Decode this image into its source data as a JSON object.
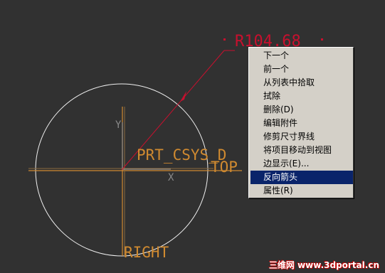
{
  "canvas": {
    "background": "#313131",
    "dimension_value": "R104.68",
    "csys_label": "PRT_CSYS_D",
    "top_label": "TOP",
    "right_label": "RIGHT",
    "x_axis_label": "X",
    "y_axis_label": "Y",
    "circle_color": "#f0f0f0",
    "datum_color": "#d08a30",
    "dimension_color": "#c8102e"
  },
  "context_menu": {
    "items": [
      {
        "label": "下一个"
      },
      {
        "label": "前一个"
      },
      {
        "label": "从列表中拾取"
      },
      {
        "label": "拭除"
      },
      {
        "label": "删除(D)"
      },
      {
        "label": "编辑附件"
      },
      {
        "label": "修剪尺寸界线"
      },
      {
        "label": "将项目移动到视图"
      },
      {
        "label": "边显示(E)..."
      },
      {
        "label": "反向箭头",
        "active": true
      },
      {
        "label": "属性(R)"
      }
    ],
    "highlight_color": "#0a246a"
  },
  "watermark": {
    "text": "三维网 www.3dportal.cn"
  }
}
